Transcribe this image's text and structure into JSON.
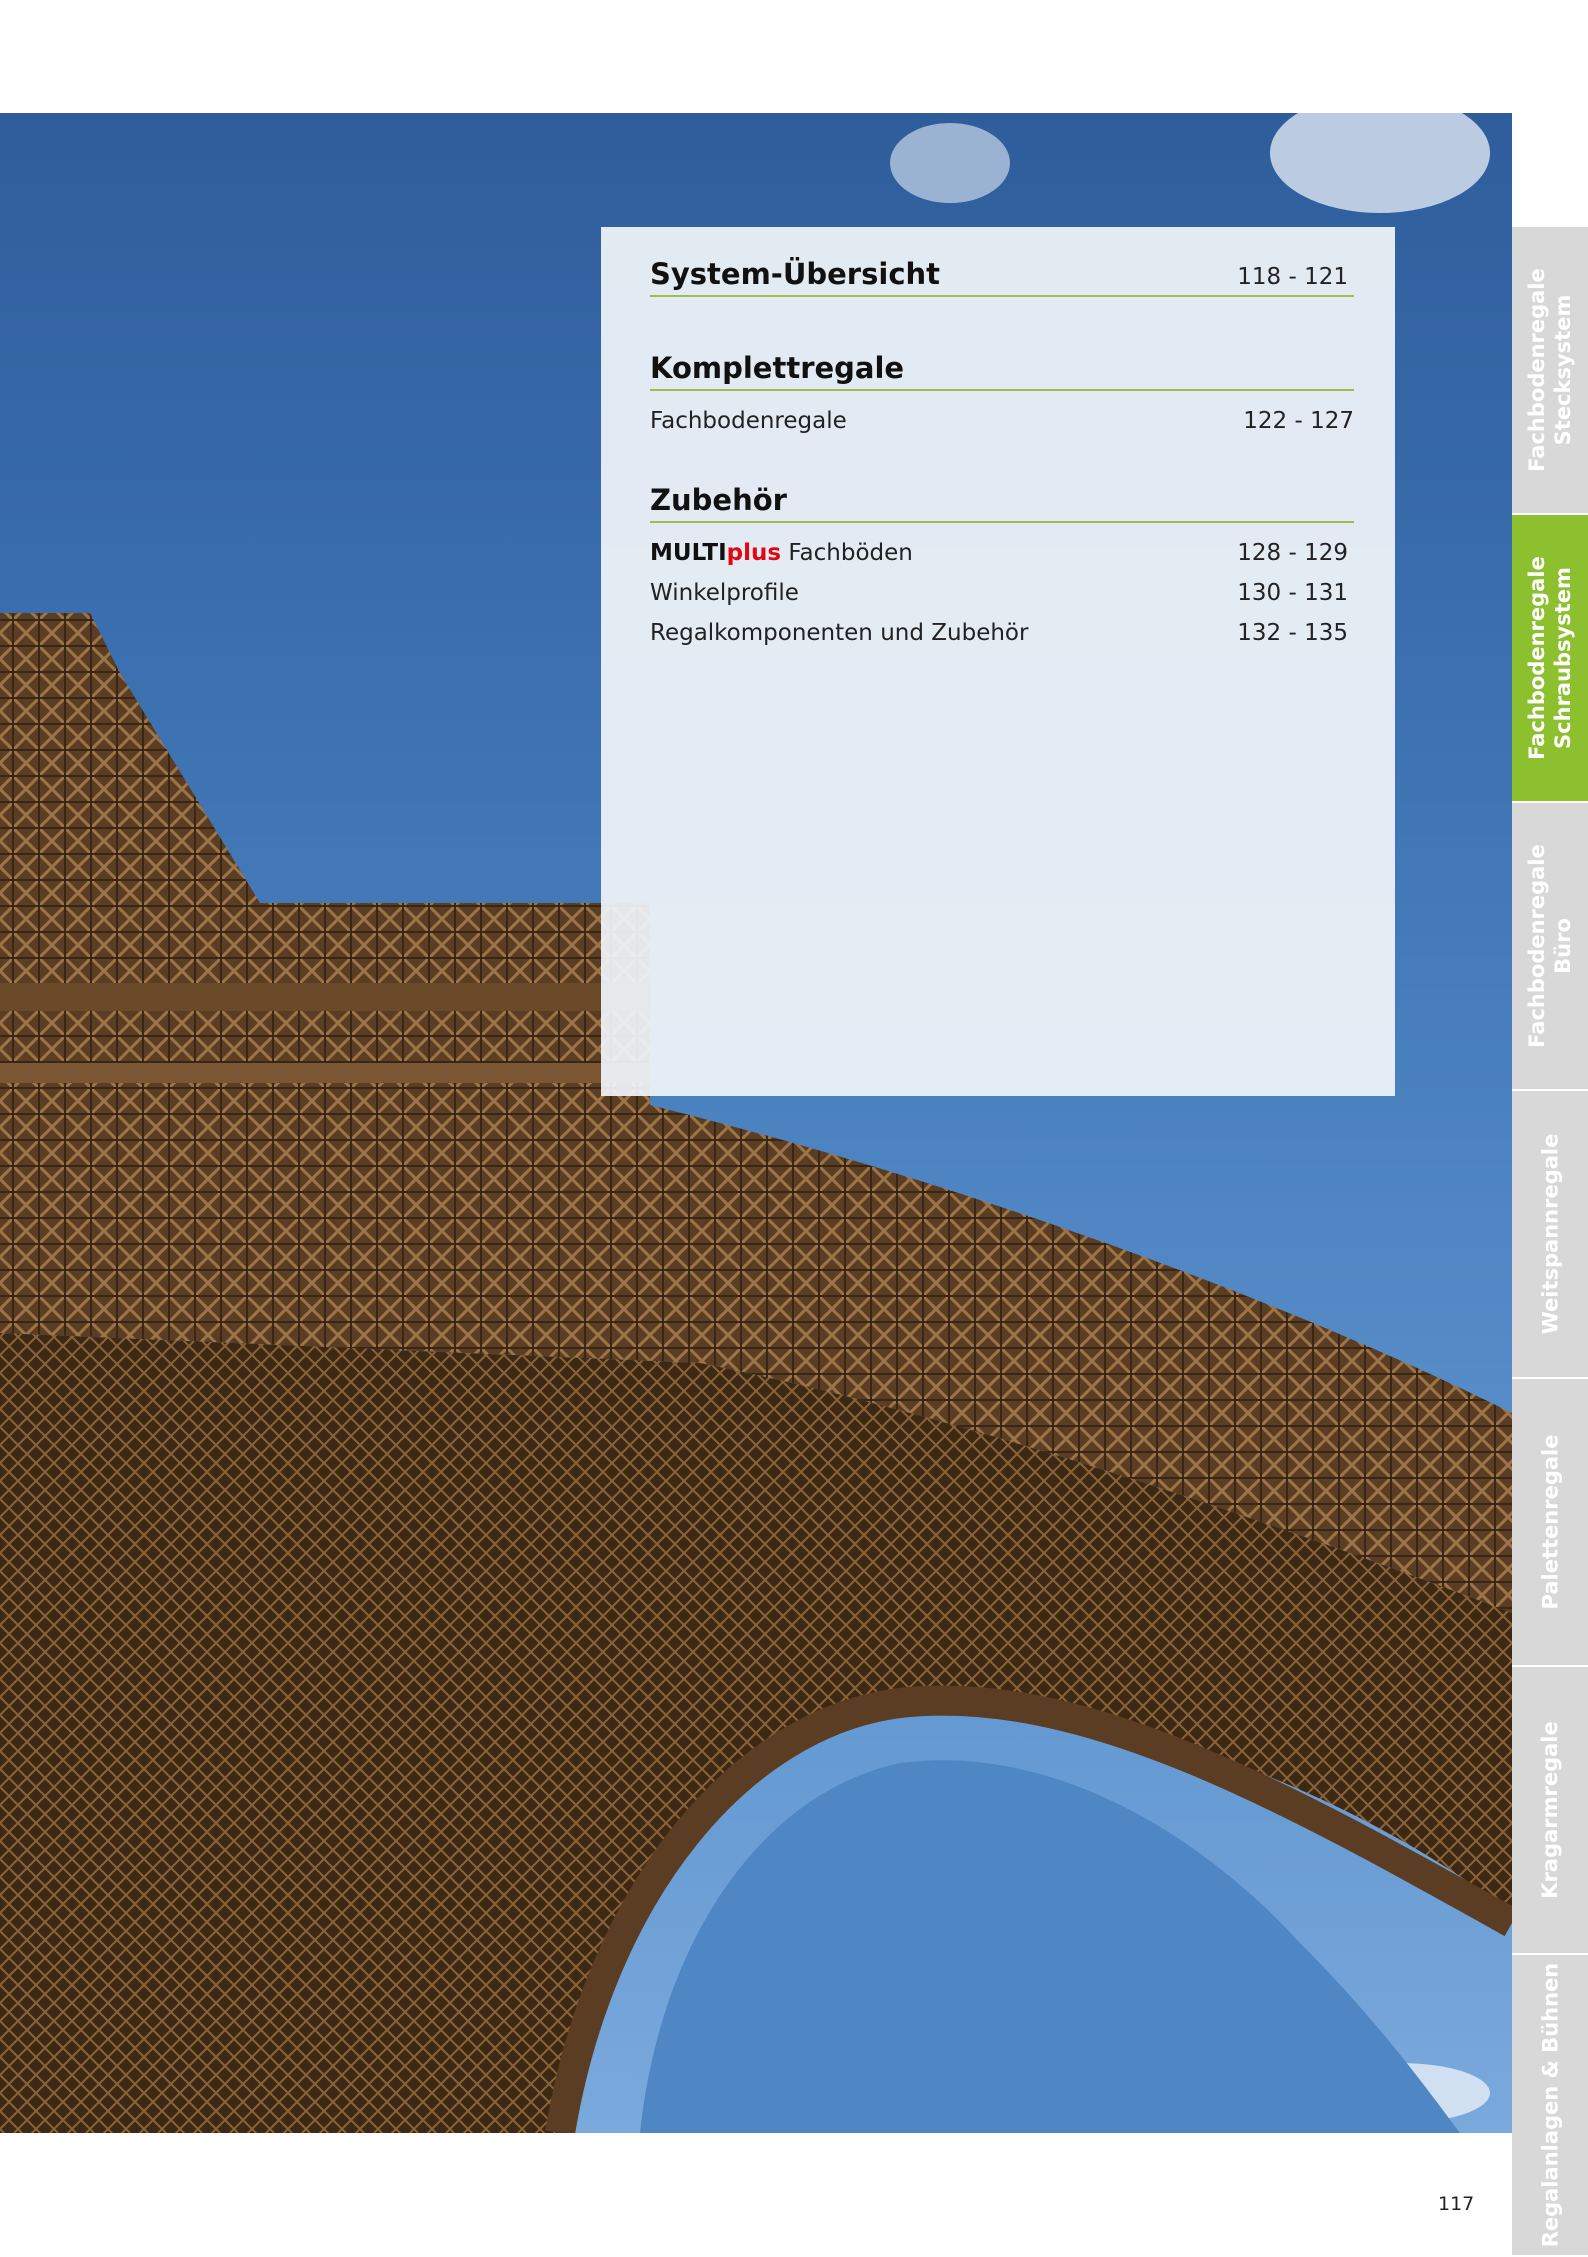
{
  "toc": {
    "sections": [
      {
        "title": "System-Übersicht",
        "pages": "118 - 121",
        "entries": []
      },
      {
        "title": "Komplettregale",
        "pages": "",
        "entries": [
          {
            "label": "Fachbodenregale",
            "pages": "122 - 127"
          }
        ]
      },
      {
        "title": "Zubehör",
        "pages": "",
        "entries": [
          {
            "brand_a": "MULTI",
            "brand_b": "plus",
            "label": "Fachböden",
            "pages": "128 - 129"
          },
          {
            "label": "Winkelprofile",
            "pages": "130 - 131"
          },
          {
            "label": "Regalkomponenten und Zubehör",
            "pages": "132 - 135"
          }
        ]
      }
    ]
  },
  "tabs": [
    {
      "line1": "Fachbodenregale",
      "line2": "Stecksystem",
      "active": false
    },
    {
      "line1": "Fachbodenregale",
      "line2": "Schraubsystem",
      "active": true
    },
    {
      "line1": "Fachbodenregale",
      "line2": "Büro",
      "active": false
    },
    {
      "line1": "Weitspannregale",
      "line2": "",
      "active": false
    },
    {
      "line1": "Palettenregale",
      "line2": "",
      "active": false
    },
    {
      "line1": "Kragarmregale",
      "line2": "",
      "active": false
    },
    {
      "line1": "Regalanlagen & Bühnen",
      "line2": "",
      "active": false
    }
  ],
  "page_number": "117",
  "colors": {
    "accent_green": "#8cc02e",
    "rule_green": "#9ac142",
    "brand_red": "#e30613",
    "tab_grey": "#d8d8d8"
  }
}
